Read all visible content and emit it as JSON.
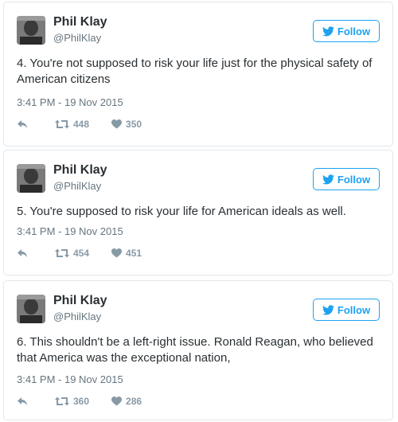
{
  "colors": {
    "accent": "#1da1f2",
    "text": "#292f33",
    "muted": "#66757f",
    "icon": "#8899a6"
  },
  "tweets": [
    {
      "name": "Phil Klay",
      "handle": "@PhilKlay",
      "follow_label": "Follow",
      "text": "4. You're not supposed to risk your life just for the physical safety of American citizens",
      "timestamp": "3:41 PM - 19 Nov 2015",
      "retweets": "448",
      "likes": "350"
    },
    {
      "name": "Phil Klay",
      "handle": "@PhilKlay",
      "follow_label": "Follow",
      "text": "5. You're supposed to risk your life for American ideals as well.",
      "timestamp": "3:41 PM - 19 Nov 2015",
      "retweets": "454",
      "likes": "451"
    },
    {
      "name": "Phil Klay",
      "handle": "@PhilKlay",
      "follow_label": "Follow",
      "text": "6. This shouldn't be a left-right issue. Ronald Reagan, who believed that America was the exceptional nation,",
      "timestamp": "3:41 PM - 19 Nov 2015",
      "retweets": "360",
      "likes": "286"
    }
  ],
  "icons": {
    "follow": "twitter-bird-icon",
    "reply": "reply-icon",
    "retweet": "retweet-icon",
    "like": "heart-icon"
  }
}
